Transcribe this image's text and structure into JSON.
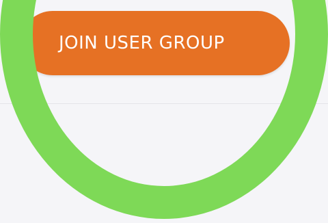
{
  "join_button": {
    "label": "JOIN USER GROUP"
  },
  "colors": {
    "page_background": "#f5f5f8",
    "button_background": "#e67124",
    "button_text": "#ffffff",
    "divider": "#e4e4e8",
    "highlight_ring": "#7ed957"
  }
}
